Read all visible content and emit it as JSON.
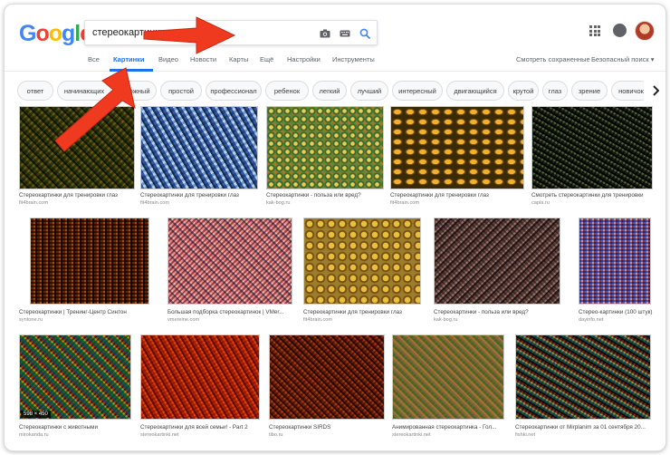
{
  "brand": {
    "logo_letters": [
      {
        "ch": "G",
        "color": "#4285F4"
      },
      {
        "ch": "o",
        "color": "#EA4335"
      },
      {
        "ch": "o",
        "color": "#FBBC05"
      },
      {
        "ch": "g",
        "color": "#4285F4"
      },
      {
        "ch": "l",
        "color": "#34A853"
      },
      {
        "ch": "e",
        "color": "#EA4335"
      }
    ]
  },
  "search": {
    "query": "стереокартинки"
  },
  "tabs": {
    "all": "Все",
    "images": "Картинки",
    "video": "Видео",
    "news": "Новости",
    "maps": "Карты",
    "more": "Ещё",
    "settings": "Настройки",
    "tools": "Инструменты",
    "saved": "Смотреть сохраненные",
    "safesearch": "Безопасный поиск ▾"
  },
  "chips": [
    "ответ",
    "начинающих",
    "сложный",
    "простой",
    "профессионал",
    "ребенок",
    "легкий",
    "лучший",
    "интересный",
    "двигающийся",
    "крутой",
    "глаз",
    "зрение",
    "новичок"
  ],
  "results": {
    "row1": [
      {
        "caption": "Стереокартинки для тренировки глаз",
        "source": "fit4brain.com"
      },
      {
        "caption": "Стереокартинки для тренировки глаз",
        "source": "fit4brain.com"
      },
      {
        "caption": "Стереокартинки - польза или вред?",
        "source": "kak-bog.ru"
      },
      {
        "caption": "Стереокартинки для тренировки глаз",
        "source": "fit4brain.com"
      },
      {
        "caption": "Смотреть стереокартинки для тренировки",
        "source": "capla.ru"
      }
    ],
    "row2": [
      {
        "caption": "Стереокартинки | Тренинг-Центр Синтон",
        "source": "syntone.ru"
      },
      {
        "caption": "Большая подборка стереокартинок | VMer...",
        "source": "vmereine.com"
      },
      {
        "caption": "Стереокартинки для тренировки глаз",
        "source": "fit4brain.com"
      },
      {
        "caption": "Стереокартинки - польза или вред?",
        "source": "kak-bog.ru"
      },
      {
        "caption": "Стерео-картинки (100 штук)",
        "source": "dayinfo.net"
      }
    ],
    "row3": [
      {
        "caption": "Стереокартинки с животными",
        "source": "mirokanda.ru",
        "badge": "598 × 450"
      },
      {
        "caption": "Стереокартинки для всей семьи! - Part 2",
        "source": "stereokartinki.net"
      },
      {
        "caption": "Стереокартинки SIRDS",
        "source": "tibo.ru"
      },
      {
        "caption": "Анимированная стереокартинка - Гол...",
        "source": "stereokartinki.net"
      },
      {
        "caption": "Стереокартинки от Mirplanim за 01 сентября 20...",
        "source": "fishki.net"
      }
    ]
  },
  "colors": {
    "accent_blue": "#1a73e8",
    "arrow_red": "#f03a1f"
  }
}
